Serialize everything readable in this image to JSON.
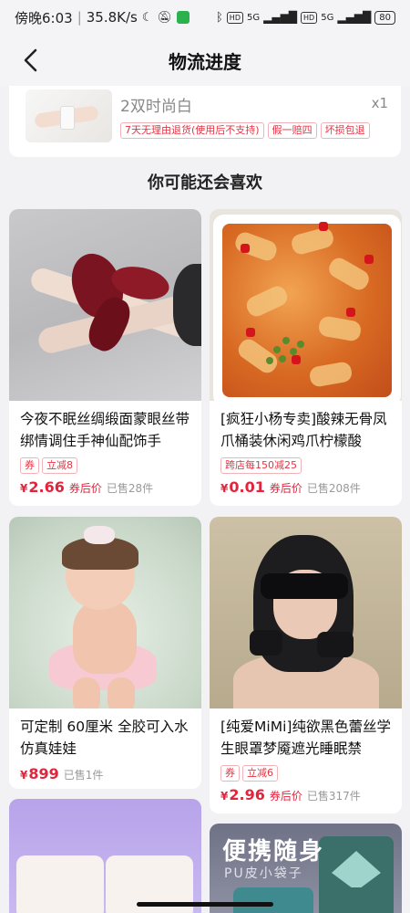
{
  "status_bar": {
    "time": "傍晚6:03",
    "speed": "35.8K/s",
    "moon_icon": "moon-icon",
    "mute_icon": "bell-off-icon",
    "network_1": "5G",
    "network_2": "5G",
    "hd": "HD",
    "battery": "80"
  },
  "nav": {
    "title": "物流进度",
    "back_icon": "chevron-left-icon"
  },
  "order": {
    "name": "2双时尚白",
    "qty": "x1",
    "tags": [
      "7天无理由退货(使用后不支持)",
      "假一赔四",
      "坏损包退"
    ]
  },
  "recommend": {
    "title": "你可能还会喜欢",
    "items": [
      {
        "title": "今夜不眠丝绸缎面蒙眼丝带绑情调住手神仙配饰手",
        "tags": [
          "券",
          "立减8"
        ],
        "price": "2.66",
        "price_note": "券后价",
        "sold": "已售28件"
      },
      {
        "title": "[疯狂小杨专卖]酸辣无骨凤爪桶装休闲鸡爪柠檬酸",
        "tags": [
          "跨店每150减25"
        ],
        "price": "0.01",
        "price_note": "券后价",
        "sold": "已售208件"
      },
      {
        "title": "可定制 60厘米 全胶可入水仿真娃娃",
        "tags": [],
        "price": "899",
        "price_note": "",
        "sold": "已售1件"
      },
      {
        "title": "[纯爱MiMi]纯欲黑色蕾丝学生眼罩梦魇遮光睡眠禁",
        "tags": [
          "券",
          "立减6"
        ],
        "price": "2.96",
        "price_note": "券后价",
        "sold": "已售317件"
      },
      {
        "image_text_main": "便携随身",
        "image_text_sub": "PU皮小袋子"
      }
    ]
  },
  "currency_symbol": "¥",
  "colors": {
    "accent_red": "#e0253d",
    "wechat_green": "#2bb24c"
  }
}
